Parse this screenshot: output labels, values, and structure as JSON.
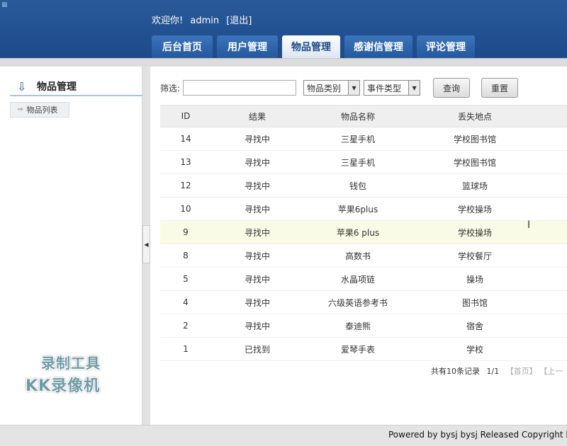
{
  "header": {
    "welcome_prefix": "欢迎你!",
    "username": "admin",
    "logout": "[退出]",
    "tabs": [
      {
        "label": "后台首页"
      },
      {
        "label": "用户管理"
      },
      {
        "label": "物品管理",
        "active": true
      },
      {
        "label": "感谢信管理"
      },
      {
        "label": "评论管理"
      }
    ]
  },
  "sidebar": {
    "title": "物品管理",
    "items": [
      {
        "label": "物品列表"
      }
    ]
  },
  "filter": {
    "label": "筛选:",
    "input_value": "",
    "category_select": "物品类别",
    "event_select": "事件类型",
    "query_button": "查询",
    "reset_button": "重置"
  },
  "table": {
    "headers": [
      "ID",
      "结果",
      "物品名称",
      "丢失地点"
    ],
    "rows": [
      {
        "id": "14",
        "result": "寻找中",
        "name": "三星手机",
        "location": "学校图书馆"
      },
      {
        "id": "13",
        "result": "寻找中",
        "name": "三星手机",
        "location": "学校图书馆"
      },
      {
        "id": "12",
        "result": "寻找中",
        "name": "钱包",
        "location": "篮球场"
      },
      {
        "id": "10",
        "result": "寻找中",
        "name": "苹果6plus",
        "location": "学校操场"
      },
      {
        "id": "9",
        "result": "寻找中",
        "name": "苹果6 plus",
        "location": "学校操场"
      },
      {
        "id": "8",
        "result": "寻找中",
        "name": "高数书",
        "location": "学校餐厅"
      },
      {
        "id": "5",
        "result": "寻找中",
        "name": "水晶项链",
        "location": "操场"
      },
      {
        "id": "4",
        "result": "寻找中",
        "name": "六级英语参考书",
        "location": "图书馆"
      },
      {
        "id": "2",
        "result": "寻找中",
        "name": "泰迪熊",
        "location": "宿舍"
      },
      {
        "id": "1",
        "result": "已找到",
        "name": "爱琴手表",
        "location": "学校"
      }
    ]
  },
  "pager": {
    "total": "共有10条记录",
    "page": "1/1",
    "first": "【首页】",
    "prev": "【上一"
  },
  "watermark": {
    "line1": "录制工具",
    "line2": "KK录像机"
  },
  "footer": {
    "text": "Powered by bysj bysj Released  Copyright b"
  },
  "colors": {
    "header_blue": "#1c4a8a",
    "row_highlight": "#fafbe6"
  }
}
